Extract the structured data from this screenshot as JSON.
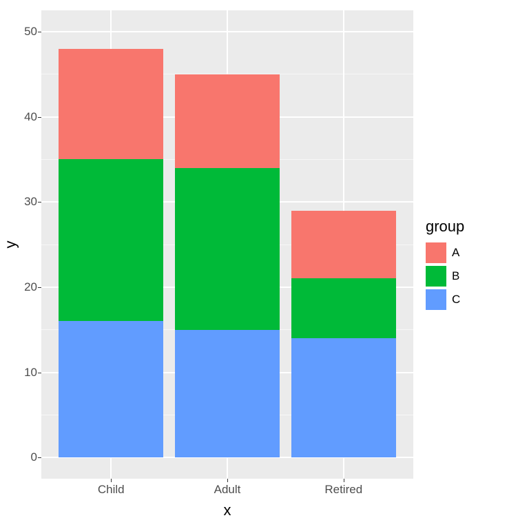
{
  "chart_data": {
    "type": "bar",
    "stacked": true,
    "categories": [
      "Child",
      "Adult",
      "Retired"
    ],
    "series": [
      {
        "name": "A",
        "values": [
          13,
          11,
          8
        ],
        "color": "#f8766d"
      },
      {
        "name": "B",
        "values": [
          19,
          19,
          7
        ],
        "color": "#00ba38"
      },
      {
        "name": "C",
        "values": [
          16,
          15,
          14
        ],
        "color": "#619cff"
      }
    ],
    "stack_order_bottom_to_top": [
      "C",
      "B",
      "A"
    ],
    "totals": [
      48,
      45,
      29
    ],
    "xlabel": "x",
    "ylabel": "y",
    "ylim": [
      0,
      50
    ],
    "y_ticks": [
      0,
      10,
      20,
      30,
      40,
      50
    ],
    "legend_title": "group",
    "legend_position": "right",
    "grid": true
  },
  "axis": {
    "x_ticks": {
      "0": "Child",
      "1": "Adult",
      "2": "Retired"
    },
    "y_ticks": {
      "0": "0",
      "1": "10",
      "2": "20",
      "3": "30",
      "4": "40",
      "5": "50"
    },
    "xlabel": "x",
    "ylabel": "y"
  },
  "legend": {
    "title": "group",
    "items": {
      "0": "A",
      "1": "B",
      "2": "C"
    }
  }
}
